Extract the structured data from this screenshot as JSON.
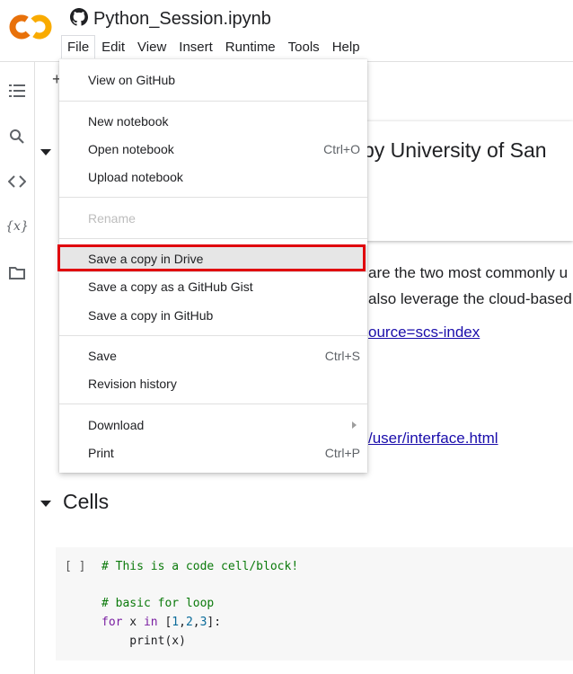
{
  "app": {
    "notebook_title": "Python_Session.ipynb",
    "brand_colors": {
      "logo_orange": "#f9ab00",
      "logo_dark_orange": "#e8710a",
      "highlight_red": "#e0000d"
    }
  },
  "menubar": {
    "items": [
      {
        "label": "File"
      },
      {
        "label": "Edit"
      },
      {
        "label": "View"
      },
      {
        "label": "Insert"
      },
      {
        "label": "Runtime"
      },
      {
        "label": "Tools"
      },
      {
        "label": "Help"
      }
    ]
  },
  "rail": {
    "icons": [
      "table-of-contents-icon",
      "search-icon",
      "code-snippets-icon",
      "variables-icon",
      "files-icon"
    ],
    "variables_glyph": "{x}"
  },
  "toolbar": {
    "plus_glyph": "+"
  },
  "notebook": {
    "heading_fragment": "by University of San",
    "para_line1": "are the two most commonly u",
    "para_line2": "also leverage the cloud-based",
    "link1": "ource=scs-index",
    "link2": "/user/interface.html",
    "cells_heading": "Cells",
    "code": {
      "bracket": "[ ]",
      "line1": "# This is a code cell/block!",
      "line2": "# basic for loop",
      "line3_kw": "for",
      "line3_var": " x ",
      "line3_in": "in",
      "line3_list_open": " [",
      "line3_n1": "1",
      "line3_c1": ",",
      "line3_n2": "2",
      "line3_c2": ",",
      "line3_n3": "3",
      "line3_close": "]:",
      "line4": "    print(x)"
    }
  },
  "file_menu": {
    "view_on_github": "View on GitHub",
    "new_notebook": "New notebook",
    "open_notebook": "Open notebook",
    "open_shortcut": "Ctrl+O",
    "upload_notebook": "Upload notebook",
    "rename": "Rename",
    "save_copy_drive": "Save a copy in Drive",
    "save_copy_gist": "Save a copy as a GitHub Gist",
    "save_copy_github": "Save a copy in GitHub",
    "save": "Save",
    "save_shortcut": "Ctrl+S",
    "revision_history": "Revision history",
    "download": "Download",
    "print": "Print",
    "print_shortcut": "Ctrl+P"
  }
}
